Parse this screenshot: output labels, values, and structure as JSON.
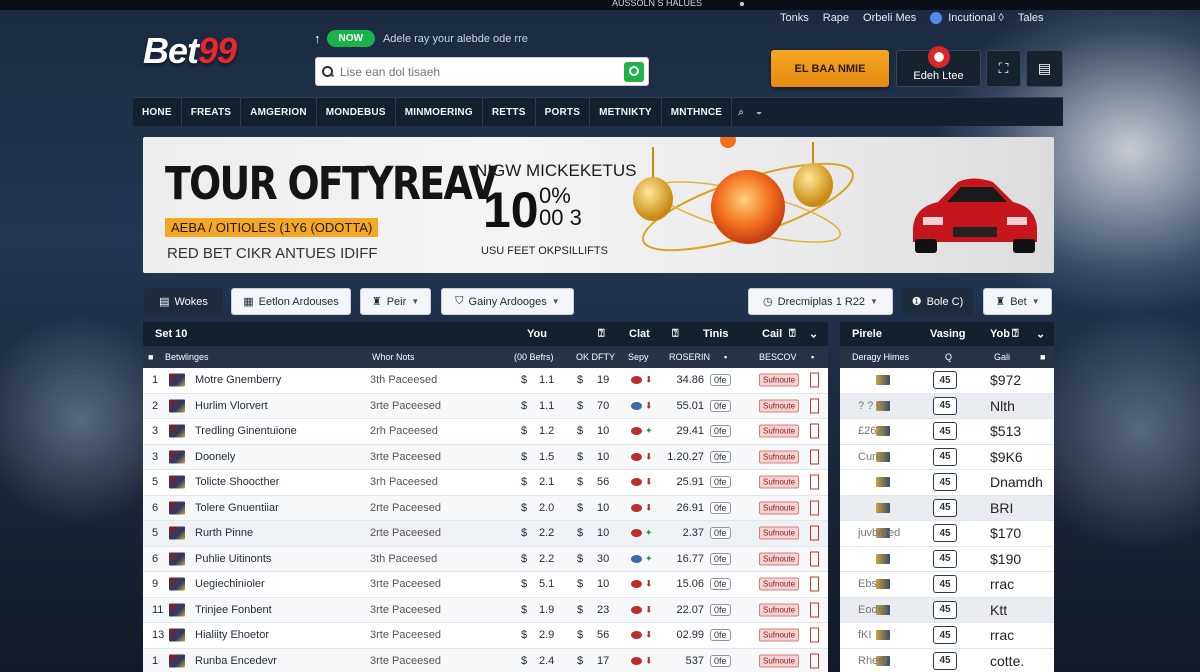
{
  "top_strip": {
    "text": "AUSSOLN S HALUES"
  },
  "top_links": [
    "Tonks",
    "Rape",
    "Orbeli Mes",
    "Incutional ◊",
    "Tales"
  ],
  "logo": {
    "text": "Bet",
    "num": "99"
  },
  "promo": {
    "badge": "NOW",
    "text": "Adele ray your alebde ode rre"
  },
  "search": {
    "placeholder": "Lise ean dol tisaeh"
  },
  "header_buttons": {
    "orange": "EL BAA NMIE",
    "login": "Edeh Ltee",
    "icon1": "⛶",
    "icon2": "▤"
  },
  "nav": [
    "HONE",
    "FREATS",
    "AMGERION",
    "MONDEBUS",
    "MINMOERING",
    "RETTS",
    "PORTS",
    "METNIKTY",
    "MNTHNCE"
  ],
  "hero": {
    "title": "TOUR OFTYREAV",
    "tag": "AEBA / OITIOLES (1Y6 (ODOTTA)",
    "subtitle": "RED BET CIKR ANTUES IDIFF",
    "mid_title": "NIGW MICKEKETUS",
    "big1": "10",
    "big2a": "0%",
    "big2b": "00 3",
    "mid_sub": "USU FEET OKPSILLIFTS"
  },
  "filters": {
    "wokes": "Wokes",
    "eetlon": "Eetlon Ardouses",
    "peir": "Peir",
    "gainy": "Gainy Ardooges",
    "dropdown": "Drecmiplas 1 R22",
    "bole": "Bole C)",
    "bet": "Bet"
  },
  "main_table": {
    "header1": {
      "title": "Set 10",
      "you": "You",
      "clat": "Clat",
      "tinis": "Tinis",
      "cail": "Cail"
    },
    "header2": {
      "col1": "Betwlinges",
      "col2": "Whor Nots",
      "col3": "(00 Befrs)",
      "col4": "OK DFTY",
      "col5": "Sepy",
      "col6": "ROSERIN",
      "col7": "BESCOV"
    },
    "rows": [
      {
        "n": "1",
        "team": "Motre Gnemberry",
        "status": "3th Paceesed",
        "v1": "1.1",
        "v2": "19",
        "tot": "34.86"
      },
      {
        "n": "2",
        "team": "Hurlim Vlorvert",
        "status": "3rte Paceesed",
        "v1": "1.1",
        "v2": "70",
        "tot": "55.01"
      },
      {
        "n": "3",
        "team": "Tredling Ginentuione",
        "status": "2rh Paceesed",
        "v1": "1.2",
        "v2": "10",
        "tot": "29.41"
      },
      {
        "n": "3",
        "team": "Doonely",
        "status": "3rte Paceesed",
        "v1": "1.5",
        "v2": "10",
        "tot": "1.20.27"
      },
      {
        "n": "5",
        "team": "Tolicte Shoocther",
        "status": "3rh Paceesed",
        "v1": "2.1",
        "v2": "56",
        "tot": "25.91"
      },
      {
        "n": "6",
        "team": "Tolere Gnuentiiar",
        "status": "2rte Paceesed",
        "v1": "2.0",
        "v2": "10",
        "tot": "26.91"
      },
      {
        "n": "5",
        "team": "Rurth Pinne",
        "status": "2rte Paceesed",
        "v1": "2.2",
        "v2": "10",
        "tot": "2.37"
      },
      {
        "n": "6",
        "team": "Puhlie Uitinonts",
        "status": "3th Paceesed",
        "v1": "2.2",
        "v2": "30",
        "tot": "16.77"
      },
      {
        "n": "9",
        "team": "Uegiechinioler",
        "status": "3rte Paceesed",
        "v1": "5.1",
        "v2": "10",
        "tot": "15.06"
      },
      {
        "n": "11",
        "team": "Trinjee Fonbent",
        "status": "3rte Paceesed",
        "v1": "1.9",
        "v2": "23",
        "tot": "22.07"
      },
      {
        "n": "13",
        "team": "Hialiity Ehoetor",
        "status": "3rte Paceesed",
        "v1": "2.9",
        "v2": "56",
        "tot": "02.99"
      },
      {
        "n": "1",
        "team": "Runba Encedevr",
        "status": "3rte Paceesed",
        "v1": "2.4",
        "v2": "17",
        "tot": "537"
      }
    ],
    "pill": "0fe",
    "red_pill": "Sufnoute"
  },
  "side_table": {
    "header1": {
      "a": "Pirele",
      "b": "Vasing",
      "c": "Yob"
    },
    "header2": {
      "a": "Deragy Himes",
      "b": "Q",
      "c": "Gali"
    },
    "box_label": "45",
    "rows": [
      {
        "left": "",
        "val": "$972"
      },
      {
        "left": "? ? Ø",
        "val": "Nlth"
      },
      {
        "left": "£262",
        "val": "$513"
      },
      {
        "left": "Cure",
        "val": "$9K6"
      },
      {
        "left": "",
        "val": "Dnamdh"
      },
      {
        "left": "",
        "val": "BRI"
      },
      {
        "left": "juvbnred",
        "val": "$170"
      },
      {
        "left": "",
        "val": "$190"
      },
      {
        "left": "Ebs",
        "val": "rrac"
      },
      {
        "left": "Eodro",
        "val": "Ktt"
      },
      {
        "left": "fKI",
        "val": "rrac"
      },
      {
        "left": "Rheer",
        "val": "cotte."
      }
    ]
  },
  "colors": {
    "accent": "#e8272d",
    "nav": "#13202e",
    "orange": "#f5a623",
    "green": "#19b34a"
  }
}
